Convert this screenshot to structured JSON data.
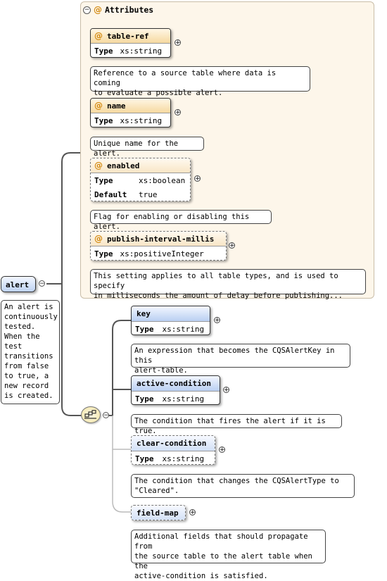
{
  "root": {
    "name": "alert",
    "doc": "An alert is\ncontinuously\n tested.\nWhen the\ntest\ntransitions\nfrom false\nto true, a\nnew record\nis created."
  },
  "attributes": {
    "header": "Attributes",
    "items": [
      {
        "name": "table-ref",
        "rows": [
          {
            "k": "Type",
            "v": "xs:string"
          }
        ],
        "doc": "Reference to a source table where data is coming\nto evaluate a possible alert."
      },
      {
        "name": "name",
        "rows": [
          {
            "k": "Type",
            "v": "xs:string"
          }
        ],
        "doc": "Unique name for the alert."
      },
      {
        "name": "enabled",
        "rows": [
          {
            "k": "Type",
            "v": "xs:boolean"
          },
          {
            "k": "Default",
            "v": "true"
          }
        ],
        "doc": "Flag for enabling or disabling this alert."
      },
      {
        "name": "publish-interval-millis",
        "rows": [
          {
            "k": "Type",
            "v": "xs:positiveInteger"
          }
        ],
        "doc": "This setting applies to all table types, and is used to specify\nin milliseconds the amount of delay before publishing..."
      }
    ]
  },
  "elements": [
    {
      "name": "key",
      "type_label": "Type",
      "type": "xs:string",
      "doc": "An expression that becomes the CQSAlertKey in this\nalert-table."
    },
    {
      "name": "active-condition",
      "type_label": "Type",
      "type": "xs:string",
      "doc": "The condition that fires the alert if it is true."
    },
    {
      "name": "clear-condition",
      "type_label": "Type",
      "type": "xs:string",
      "doc": "The condition that changes the CQSAlertType to\n\"Cleared\"."
    },
    {
      "name": "field-map",
      "doc": "Additional fields that should propagate from\nthe source table to the alert table when the\nactive-condition is satisfied."
    }
  ],
  "icons": {
    "collapse": "minus-toggle-icon",
    "expand": "plus-toggle-icon",
    "attribute": "at-sign-icon",
    "sequence": "sequence-compositor-icon"
  },
  "colors": {
    "attribute_header": "#f6d9a0",
    "element_header": "#b9cff2",
    "group_bg": "#fdf6ea"
  }
}
